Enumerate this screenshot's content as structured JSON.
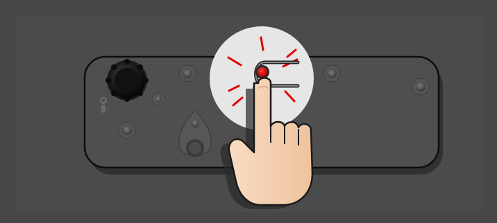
{
  "illustration": {
    "subject": "tap-gesture-on-device-button",
    "colors": {
      "background": "#474747",
      "panel": "#4b4b4b",
      "device": "#4f4f4f",
      "device_outline": "#0d0d0d",
      "highlight_circle": "#e6e6e6",
      "button_light": "#e00000",
      "tap_rays": "#e00000",
      "skin": "#f6d3b4",
      "skin_outline": "#1a1a1a"
    },
    "icons": [
      "hand-pointer-icon",
      "knob-icon",
      "button-slot-icon",
      "screw-icon"
    ]
  }
}
